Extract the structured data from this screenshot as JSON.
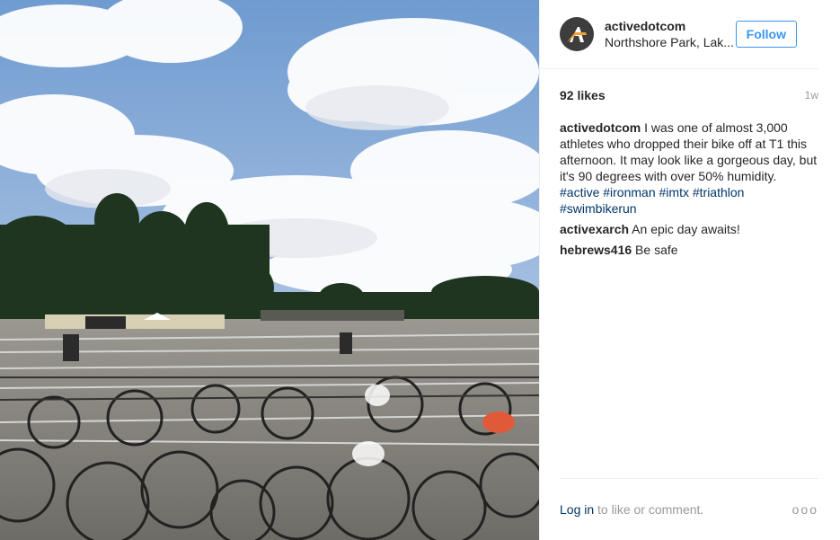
{
  "post": {
    "username": "activedotcom",
    "location": "Northshore Park, Lak...",
    "follow_label": "Follow",
    "likes": "92 likes",
    "time": "1w"
  },
  "caption": {
    "user": "activedotcom",
    "text": " I was one of almost 3,000 athletes who dropped their bike off at T1 this afternoon. It may look like a gorgeous day, but it's 90 degrees with over 50% humidity. ",
    "tags": [
      "#active",
      "#ironman",
      "#imtx",
      "#triathlon",
      "#swimbikerun"
    ]
  },
  "comments": [
    {
      "user": "activexarch",
      "text": " An epic day awaits!"
    },
    {
      "user": "hebrews416",
      "text": " Be safe"
    }
  ],
  "footer": {
    "login": "Log in",
    "rest": " to like or comment.",
    "more": "ooo"
  },
  "colors": {
    "link": "#003569",
    "follow": "#3897f0",
    "sky": "#7aa3d6"
  },
  "icons": {
    "avatar": "active-logo-icon",
    "more": "more-options-icon"
  }
}
